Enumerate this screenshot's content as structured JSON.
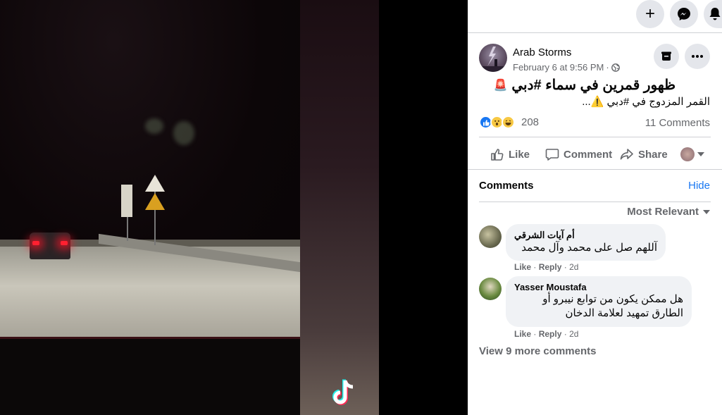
{
  "topbar": {
    "create_label": "+",
    "icons": [
      "plus-icon",
      "messenger-icon",
      "notifications-icon"
    ]
  },
  "post": {
    "author": "Arab Storms",
    "date": "February 6 at 9:56 PM",
    "separator": "·",
    "title": "ظهور قمرين في سماء #دبي",
    "title_emoji": "🚨",
    "subtitle": "القمر المزدوج في #دبي ⚠️...",
    "reaction_count": "208",
    "comment_count": "11 Comments",
    "actions": {
      "like": "Like",
      "comment": "Comment",
      "share": "Share"
    }
  },
  "comments_section": {
    "heading": "Comments",
    "hide_label": "Hide",
    "sort_label": "Most Relevant",
    "items": [
      {
        "name": "أم آيات الشرقي",
        "text_lines": [
          "آللهم صل على محمد وآل محمد"
        ],
        "like": "Like",
        "dot": "·",
        "reply": "Reply",
        "time": "2d"
      },
      {
        "name": "Yasser Moustafa",
        "text_lines": [
          "هل ممكن يكون من توابع نيبرو أو",
          "الطارق تمهيد لعلامة الدخان"
        ],
        "like": "Like",
        "dot": "·",
        "reply": "Reply",
        "time": "2d"
      }
    ],
    "view_more": "View 9 more comments"
  },
  "colors": {
    "link": "#1877f2",
    "muted": "#65676b",
    "bubble": "#f0f2f5"
  }
}
